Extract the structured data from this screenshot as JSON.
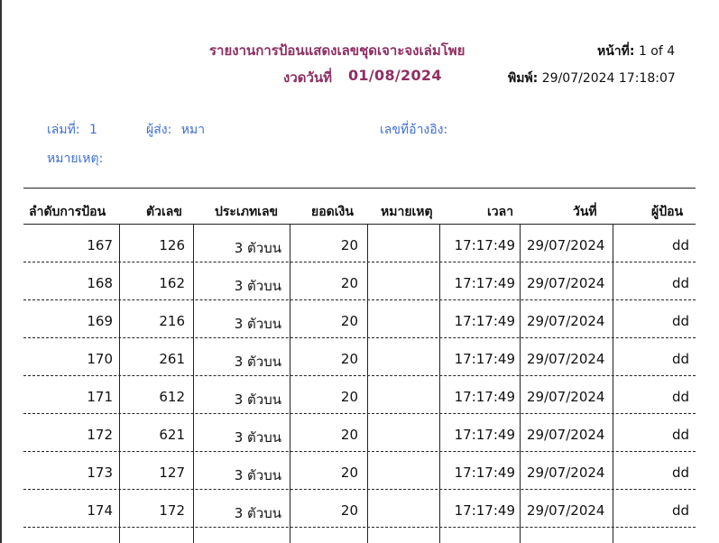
{
  "report": {
    "title": "รายงานการป้อนแสดงเลขชุดเจาะจงเล่มโพย",
    "draw_label": "งวดวันที่",
    "draw_date": "01/08/2024",
    "page_label": "หน้าที่:",
    "page_value": "1 of 4",
    "printed_label": "พิมพ์:",
    "printed_value": "29/07/2024 17:18:07"
  },
  "meta": {
    "book_label": "เล่มที่:",
    "book_value": "1",
    "sender_label": "ผู้ส่ง:",
    "sender_value": "หมา",
    "reference_label": "เลขที่อ้างอิง:",
    "reference_value": "",
    "note_label": "หมายเหตุ:",
    "note_value": ""
  },
  "table": {
    "columns": [
      "ลำดับการป้อน",
      "ตัวเลข",
      "ประเภทเลข",
      "ยอดเงิน",
      "หมายเหตุ",
      "เวลา",
      "วันที่",
      "ผู้ป้อน"
    ],
    "rows": [
      [
        "167",
        "126",
        "3 ตัวบน",
        "20",
        "",
        "17:17:49",
        "29/07/2024",
        "dd"
      ],
      [
        "168",
        "162",
        "3 ตัวบน",
        "20",
        "",
        "17:17:49",
        "29/07/2024",
        "dd"
      ],
      [
        "169",
        "216",
        "3 ตัวบน",
        "20",
        "",
        "17:17:49",
        "29/07/2024",
        "dd"
      ],
      [
        "170",
        "261",
        "3 ตัวบน",
        "20",
        "",
        "17:17:49",
        "29/07/2024",
        "dd"
      ],
      [
        "171",
        "612",
        "3 ตัวบน",
        "20",
        "",
        "17:17:49",
        "29/07/2024",
        "dd"
      ],
      [
        "172",
        "621",
        "3 ตัวบน",
        "20",
        "",
        "17:17:49",
        "29/07/2024",
        "dd"
      ],
      [
        "173",
        "127",
        "3 ตัวบน",
        "20",
        "",
        "17:17:49",
        "29/07/2024",
        "dd"
      ],
      [
        "174",
        "172",
        "3 ตัวบน",
        "20",
        "",
        "17:17:49",
        "29/07/2024",
        "dd"
      ]
    ]
  },
  "colors": {
    "title": "#8e2f63",
    "meta_text": "#3f6fd6"
  }
}
